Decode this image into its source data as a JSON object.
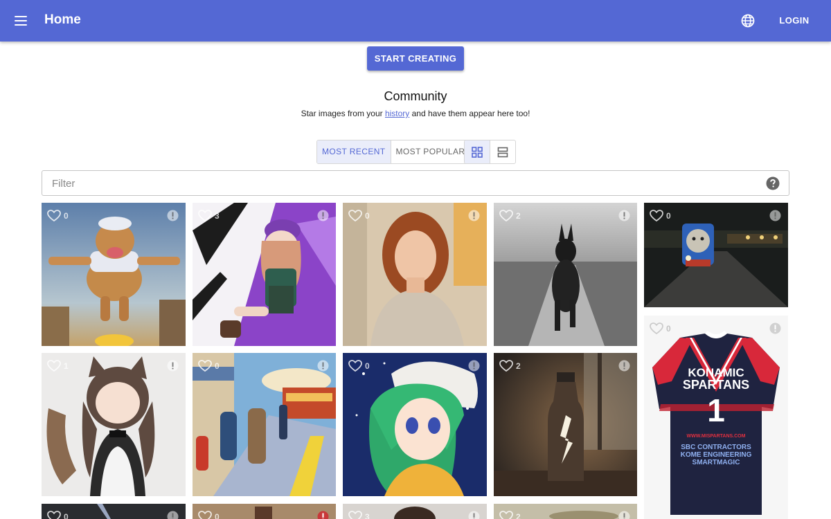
{
  "appbar": {
    "title": "Home",
    "login_label": "LOGIN",
    "menu_icon": "hamburger-menu-icon",
    "language_icon": "globe-icon",
    "color": "#5468d4"
  },
  "cta": {
    "label": "START CREATING"
  },
  "community": {
    "title": "Community",
    "subtitle_before": "Star images from your ",
    "subtitle_link": "history",
    "subtitle_after": " and have them appear here too!"
  },
  "sort_tabs": [
    {
      "label": "MOST RECENT",
      "selected": true
    },
    {
      "label": "MOST POPULAR",
      "selected": false
    }
  ],
  "view_modes": [
    {
      "icon": "grid-view-icon",
      "selected": true
    },
    {
      "icon": "list-view-icon",
      "selected": false
    }
  ],
  "filter": {
    "value": "",
    "placeholder": "Filter",
    "help_icon": "help-circle-icon"
  },
  "images": [
    {
      "likes": "0",
      "subject": "flying-dog"
    },
    {
      "likes": "3",
      "subject": "anime-girl-purple-hat"
    },
    {
      "likes": "0",
      "subject": "portrait-redhead-woman"
    },
    {
      "likes": "2",
      "subject": "black-dog-on-path"
    },
    {
      "likes": "0",
      "subject": "toy-train-at-night"
    },
    {
      "likes": "1",
      "subject": "anime-maid-girl"
    },
    {
      "likes": "0",
      "subject": "train-station-painting"
    },
    {
      "likes": "0",
      "subject": "anime-girl-green-hair"
    },
    {
      "likes": "2",
      "subject": "lightning-in-bottle"
    },
    {
      "likes": "0",
      "subject": "rugby-jersey"
    },
    {
      "likes": "0",
      "subject": "dark-storm"
    },
    {
      "likes": "0",
      "subject": "painted-figure"
    },
    {
      "likes": "3",
      "subject": "portrait-dark-hair"
    },
    {
      "likes": "2",
      "subject": "blurred-scene"
    }
  ],
  "jersey": {
    "line1": "KONAMIC",
    "line2": "SPARTANS",
    "number": "1",
    "url": "WWW.MISPARTANS.COM",
    "sponsor1": "SBC CONTRACTORS",
    "sponsor2": "KOME ENGINEERING",
    "sponsor3": "SMARTMAGIC"
  }
}
